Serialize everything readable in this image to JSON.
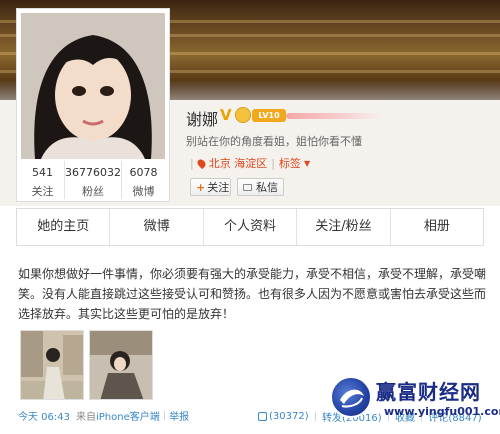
{
  "profile": {
    "name": "谢娜",
    "verified_mark": "V",
    "level_badge": "LV10",
    "bio": "别站在你的角度看姐，姐怕你看不懂",
    "location": "北京 海淀区",
    "tags_label": "标签",
    "stats": [
      {
        "value": "541",
        "label": "关注"
      },
      {
        "value": "36776032",
        "label": "粉丝"
      },
      {
        "value": "6078",
        "label": "微博"
      }
    ],
    "follow_button": "关注",
    "message_button": "私信"
  },
  "tabs": [
    "她的主页",
    "微博",
    "个人资料",
    "关注/粉丝",
    "相册"
  ],
  "post": {
    "text": "如果你想做好一件事情，你必须要有强大的承受能力，承受不相信，承受不理解，承受嘲笑。没有人能直接跳过这些接受认可和赞扬。也有很多人因为不愿意或害怕去承受这些而选择放弃。其实比这些更可怕的是放弃！",
    "time": "今天 06:43",
    "source_prefix": "来自",
    "client": "iPhone客户端",
    "report": "举报",
    "likes": "(30372)",
    "repost": "转发(20016)",
    "favorite": "收藏",
    "comment": "评论(8847)"
  },
  "watermark": {
    "title": "赢富财经网",
    "url": "www.yingfu001.com"
  },
  "colors": {
    "accent_orange": "#e0471d",
    "link_blue": "#3a87c8",
    "watermark_blue": "#1a2c86"
  }
}
